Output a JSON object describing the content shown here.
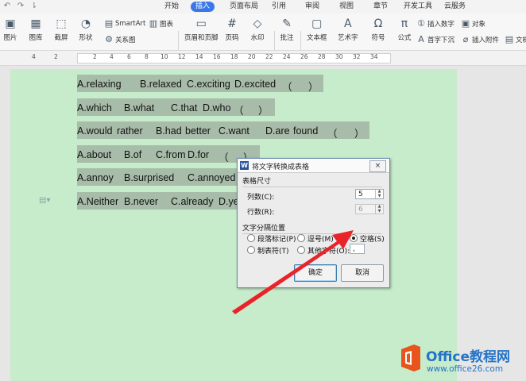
{
  "tabs": [
    "开始",
    "插入",
    "页面布局",
    "引用",
    "审阅",
    "视图",
    "章节",
    "开发工具",
    "云服务"
  ],
  "active_tab": "插入",
  "ribbon": {
    "picture": "图片",
    "gallery": "图库",
    "screenshot": "截屏",
    "shapes": "形状",
    "smartart": "SmartArt",
    "chart": "图表",
    "relation": "关系图",
    "header_footer": "页眉和页脚",
    "page_number": "页码",
    "watermark": "水印",
    "comment": "批注",
    "textbox": "文本框",
    "wordart": "艺术字",
    "symbol": "符号",
    "formula": "公式",
    "insert_number": "插入数字",
    "object": "对象",
    "dropcap": "首字下沉",
    "attachment": "插入附件",
    "doc": "文档"
  },
  "ruler_numbers": [
    "4",
    "2",
    "2",
    "4",
    "6",
    "8",
    "10",
    "12",
    "14",
    "16",
    "18",
    "20",
    "22",
    "24",
    "26",
    "28",
    "30",
    "32",
    "34"
  ],
  "document_lines": [
    [
      "A.relaxing",
      "B.relaxed",
      "C.exciting",
      "D.excited",
      "（",
      "）"
    ],
    [
      "A.which",
      "B.what",
      "C.that",
      "D.who",
      "（",
      "）"
    ],
    [
      "A.would",
      "rather",
      "B.had",
      "better",
      "C.want",
      "D.are",
      "found",
      "（",
      "）"
    ],
    [
      "A.about",
      "B.of",
      "C.from",
      "D.for",
      "（",
      "）"
    ],
    [
      "A.annoy",
      "B.surprised",
      "C.annoyed"
    ],
    [
      "A.Neither",
      "B.never",
      "C.already",
      "D.yet"
    ]
  ],
  "dialog": {
    "title": "将文字转换成表格",
    "close": "×",
    "size_group": "表格尺寸",
    "cols_label": "列数(C):",
    "cols_value": "5",
    "rows_label": "行数(R):",
    "rows_value": "6",
    "sep_group": "文字分隔位置",
    "opt_paragraph": "段落标记(P)",
    "opt_comma": "逗号(M)",
    "opt_space": "空格(S)",
    "opt_tab": "制表符(T)",
    "opt_other": "其他字符(O):",
    "other_value": ",",
    "selected_option": "空格(S)",
    "ok": "确定",
    "cancel": "取消"
  },
  "logo": {
    "brand": "Office教程网",
    "url": "www.office26.com"
  },
  "colors": {
    "page": "#c7eccb",
    "selection": "#a8bcaa",
    "arrow": "#e8242a",
    "active_tab": "#3b78e7",
    "logo_orange": "#e8541c"
  }
}
